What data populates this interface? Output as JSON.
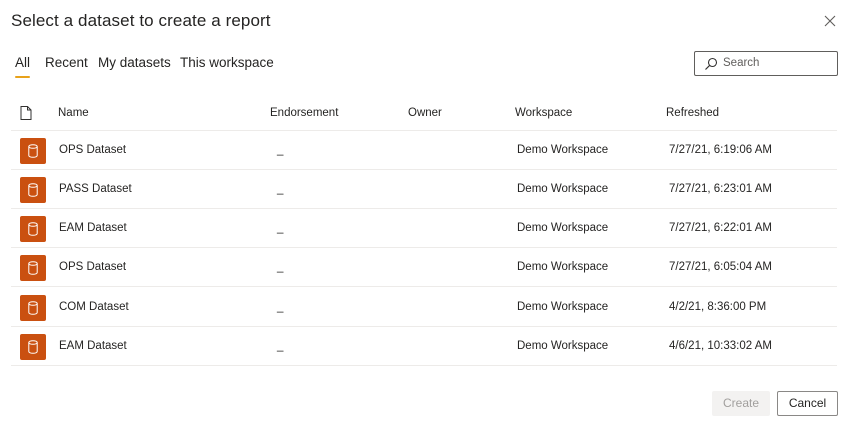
{
  "dialog": {
    "title": "Select a dataset to create a report",
    "close_icon": "close-icon"
  },
  "tabs": [
    {
      "label": "All",
      "active": true
    },
    {
      "label": "Recent",
      "active": false
    },
    {
      "label": "My datasets",
      "active": false
    },
    {
      "label": "This workspace",
      "active": false
    }
  ],
  "search": {
    "placeholder": "Search",
    "icon": "search-icon"
  },
  "table": {
    "header_icon": "file-icon",
    "columns": [
      "Name",
      "Endorsement",
      "Owner",
      "Workspace",
      "Refreshed"
    ],
    "rows": [
      {
        "icon": "dataset-icon",
        "name": "OPS Dataset",
        "endorsement": "_",
        "owner": "",
        "workspace": "Demo Workspace",
        "refreshed": "7/27/21, 6:19:06 AM"
      },
      {
        "icon": "dataset-icon",
        "name": "PASS Dataset",
        "endorsement": "_",
        "owner": "",
        "workspace": "Demo Workspace",
        "refreshed": "7/27/21, 6:23:01 AM"
      },
      {
        "icon": "dataset-icon",
        "name": "EAM Dataset",
        "endorsement": "_",
        "owner": "",
        "workspace": "Demo Workspace",
        "refreshed": "7/27/21, 6:22:01 AM"
      },
      {
        "icon": "dataset-icon",
        "name": "OPS Dataset",
        "endorsement": "_",
        "owner": "",
        "workspace": "Demo Workspace",
        "refreshed": "7/27/21, 6:05:04 AM"
      },
      {
        "icon": "dataset-icon",
        "name": "COM Dataset",
        "endorsement": "_",
        "owner": "",
        "workspace": "Demo Workspace",
        "refreshed": "4/2/21, 8:36:00 PM"
      },
      {
        "icon": "dataset-icon",
        "name": "EAM Dataset",
        "endorsement": "_",
        "owner": "",
        "workspace": "Demo Workspace",
        "refreshed": "4/6/21, 10:33:02 AM"
      }
    ]
  },
  "footer": {
    "create_label": "Create",
    "create_enabled": false,
    "cancel_label": "Cancel"
  },
  "colors": {
    "accent": "#E8A21A",
    "dataset_icon": "#CA5010",
    "divider": "#EDEBE9",
    "text": "#252423"
  }
}
